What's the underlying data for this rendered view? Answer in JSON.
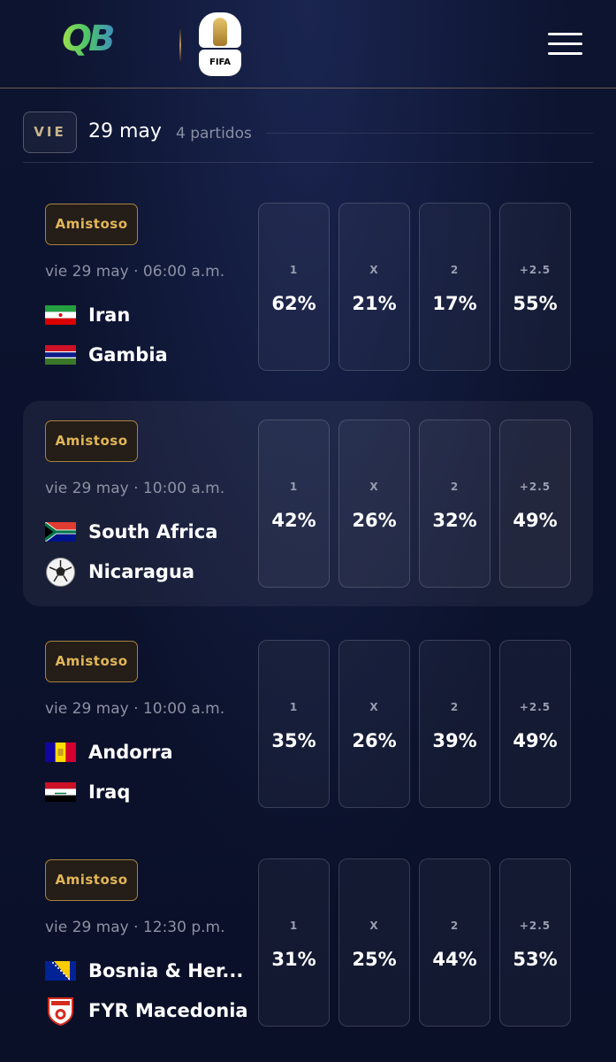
{
  "header": {
    "brand_logo": "qb-logo",
    "event_logo_text": "FIFA",
    "menu_icon": "hamburger-menu-icon"
  },
  "date_group": {
    "day": "VIE",
    "date": "29 may",
    "count": "4 partidos"
  },
  "odds_labels": [
    "1",
    "X",
    "2",
    "+2.5"
  ],
  "matches": [
    {
      "badge": "Amistoso",
      "time": "vie 29 may · 06:00 a.m.",
      "home": {
        "name": "Iran",
        "flag": "iran-flag-icon"
      },
      "away": {
        "name": "Gambia",
        "flag": "gambia-flag-icon"
      },
      "odds": [
        "62%",
        "21%",
        "17%",
        "55%"
      ]
    },
    {
      "badge": "Amistoso",
      "time": "vie 29 may · 10:00 a.m.",
      "home": {
        "name": "South Africa",
        "flag": "south-africa-flag-icon"
      },
      "away": {
        "name": "Nicaragua",
        "flag": "soccer-ball-icon"
      },
      "odds": [
        "42%",
        "26%",
        "32%",
        "49%"
      ]
    },
    {
      "badge": "Amistoso",
      "time": "vie 29 may · 10:00 a.m.",
      "home": {
        "name": "Andorra",
        "flag": "andorra-flag-icon"
      },
      "away": {
        "name": "Iraq",
        "flag": "iraq-flag-icon"
      },
      "odds": [
        "35%",
        "26%",
        "39%",
        "49%"
      ]
    },
    {
      "badge": "Amistoso",
      "time": "vie 29 may · 12:30 p.m.",
      "home": {
        "name": "Bosnia & Her...",
        "flag": "bosnia-flag-icon"
      },
      "away": {
        "name": "FYR Macedonia",
        "flag": "macedonia-fa-crest-icon"
      },
      "odds": [
        "31%",
        "25%",
        "44%",
        "53%"
      ]
    }
  ],
  "colors": {
    "background": "#0d1430",
    "badge_text": "#e1b657",
    "badge_border": "#a8823e",
    "muted_text": "#8d91a4"
  }
}
